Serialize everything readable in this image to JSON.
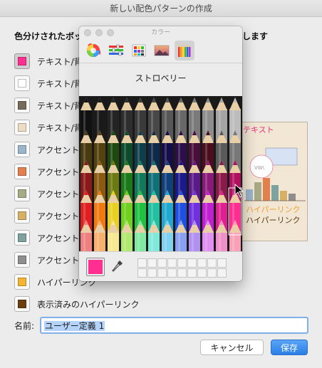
{
  "dialog": {
    "title": "新しい配色パターンの作成",
    "heading": "色分けされたボッ",
    "heading_tail": "します",
    "rows": [
      {
        "label": "テキスト/背",
        "color": "#ff2f92",
        "active": true
      },
      {
        "label": "テキスト/背",
        "color": "#ffffff"
      },
      {
        "label": "テキスト/背",
        "color": "#766a5b"
      },
      {
        "label": "テキスト/背",
        "color": "#eddcc4"
      },
      {
        "label": "アクセント",
        "color": "#9bb5cc"
      },
      {
        "label": "アクセント",
        "color": "#e37f4c"
      },
      {
        "label": "アクセント",
        "color": "#a7ab85"
      },
      {
        "label": "アクセント",
        "color": "#d6b064"
      },
      {
        "label": "アクセント",
        "color": "#7da2a0"
      },
      {
        "label": "アクセント",
        "color": "#8e8e8e"
      },
      {
        "label": "ハイパーリンク",
        "color": "#f5b32f"
      },
      {
        "label": "表示済みのハイパーリンク",
        "color": "#6b3e10"
      }
    ],
    "name_label": "名前:",
    "name_value": "ユーザー定義 1",
    "cancel_label": "キャンセル",
    "save_label": "保存"
  },
  "preview": {
    "text_sample": "テキスト",
    "link_sample": "ハイパーリンク",
    "visited_link_sample": "ハイパーリンク",
    "text_color": "#e8327e"
  },
  "picker": {
    "title": "カラー",
    "palette_name": "ストロベリー",
    "current_color": "#ff2f92",
    "tools": [
      "color-wheel-icon",
      "sliders-icon",
      "palettes-icon",
      "image-palettes-icon",
      "pencils-icon"
    ],
    "selected_tool": "pencils-icon"
  }
}
